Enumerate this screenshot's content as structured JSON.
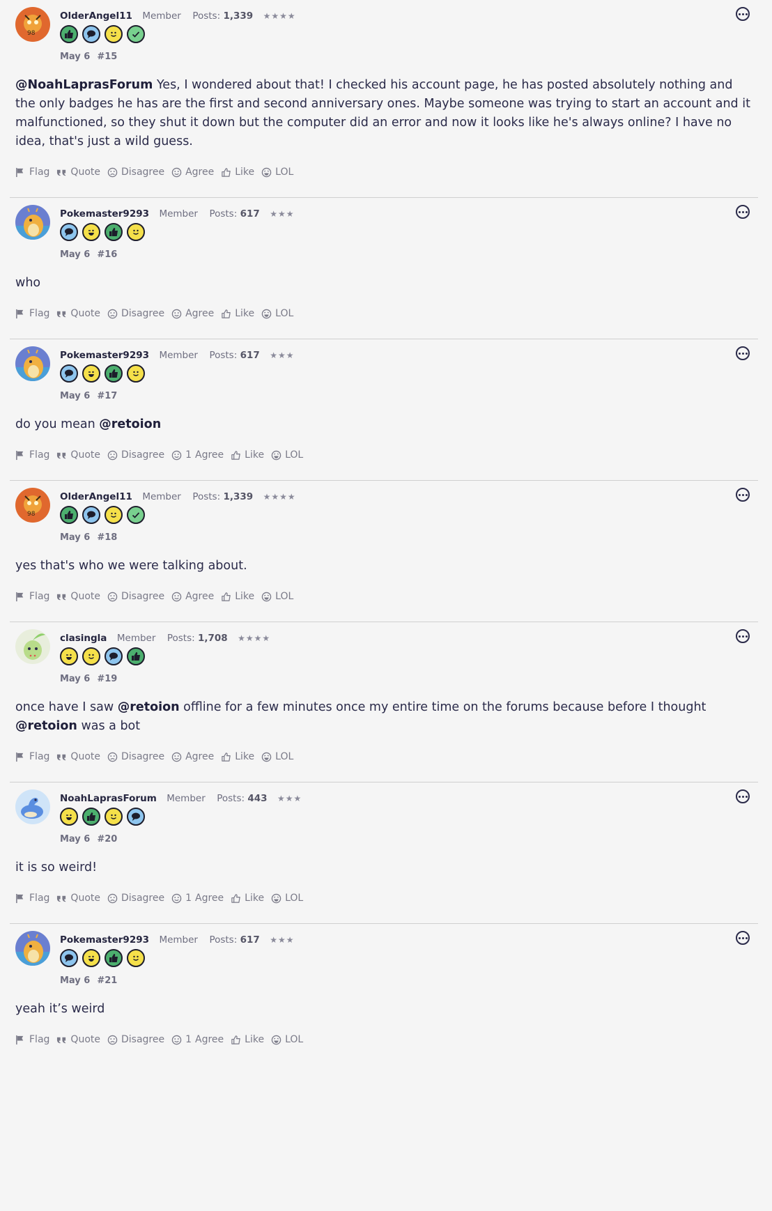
{
  "labels": {
    "flag": "Flag",
    "quote": "Quote",
    "disagree": "Disagree",
    "agree": "Agree",
    "like": "Like",
    "lol": "LOL",
    "posts_prefix": "Posts:"
  },
  "posts": [
    {
      "username": "OlderAngel11",
      "role": "Member",
      "post_count": "1,339",
      "stars": "★★★★",
      "avatar": "fire-pokemon-avatar",
      "avatar_color": "#e0682e",
      "badges": [
        "thumbs-up",
        "chat",
        "smile",
        "check"
      ],
      "date": "May 6",
      "number": "#15",
      "body": [
        {
          "type": "mention",
          "text": "@NoahLaprasForum"
        },
        {
          "type": "text",
          "text": " Yes, I wondered about that! I checked his account page, he has posted absolutely nothing and the only badges he has are the first and second anniversary ones. Maybe someone was trying to start an account and it malfunctioned, so they shut it down but the computer did an error and now it looks like he's always online? I have no idea, that's just a wild guess."
        }
      ],
      "agree_count": ""
    },
    {
      "username": "Pokemaster9293",
      "role": "Member",
      "post_count": "617",
      "stars": "★★★",
      "avatar": "dragonite-avatar",
      "avatar_color": "#6a7fd0",
      "badges": [
        "chat",
        "wink",
        "thumbs-up",
        "smile"
      ],
      "date": "May 6",
      "number": "#16",
      "body": [
        {
          "type": "text",
          "text": "who"
        }
      ],
      "agree_count": ""
    },
    {
      "username": "Pokemaster9293",
      "role": "Member",
      "post_count": "617",
      "stars": "★★★",
      "avatar": "dragonite-avatar",
      "avatar_color": "#6a7fd0",
      "badges": [
        "chat",
        "wink",
        "thumbs-up",
        "smile"
      ],
      "date": "May 6",
      "number": "#17",
      "body": [
        {
          "type": "text",
          "text": "do you mean "
        },
        {
          "type": "mention",
          "text": "@retoion"
        }
      ],
      "agree_count": "1"
    },
    {
      "username": "OlderAngel11",
      "role": "Member",
      "post_count": "1,339",
      "stars": "★★★★",
      "avatar": "fire-pokemon-avatar",
      "avatar_color": "#e0682e",
      "badges": [
        "thumbs-up",
        "chat",
        "smile",
        "check"
      ],
      "date": "May 6",
      "number": "#18",
      "body": [
        {
          "type": "text",
          "text": "yes that's who we were talking about."
        }
      ],
      "agree_count": ""
    },
    {
      "username": "clasingla",
      "role": "Member",
      "post_count": "1,708",
      "stars": "★★★★",
      "avatar": "chikorita-avatar",
      "avatar_color": "#8fcf6a",
      "badges": [
        "wink",
        "smile",
        "chat",
        "thumbs-up"
      ],
      "date": "May 6",
      "number": "#19",
      "body": [
        {
          "type": "text",
          "text": "once have I saw "
        },
        {
          "type": "mention",
          "text": "@retoion"
        },
        {
          "type": "text",
          "text": " offline for a few minutes once my entire time on the forums because before I thought "
        },
        {
          "type": "mention",
          "text": "@retoion"
        },
        {
          "type": "text",
          "text": " was a bot"
        }
      ],
      "agree_count": ""
    },
    {
      "username": "NoahLaprasForum",
      "role": "Member",
      "post_count": "443",
      "stars": "★★★",
      "avatar": "lapras-avatar",
      "avatar_color": "#5a8ee0",
      "badges": [
        "wink",
        "thumbs-up",
        "smile",
        "chat"
      ],
      "date": "May 6",
      "number": "#20",
      "body": [
        {
          "type": "text",
          "text": "it is so weird!"
        }
      ],
      "agree_count": "1"
    },
    {
      "username": "Pokemaster9293",
      "role": "Member",
      "post_count": "617",
      "stars": "★★★",
      "avatar": "dragonite-avatar",
      "avatar_color": "#6a7fd0",
      "badges": [
        "chat",
        "wink",
        "thumbs-up",
        "smile"
      ],
      "date": "May 6",
      "number": "#21",
      "body": [
        {
          "type": "text",
          "text": "yeah it’s weird"
        }
      ],
      "agree_count": "1"
    }
  ]
}
